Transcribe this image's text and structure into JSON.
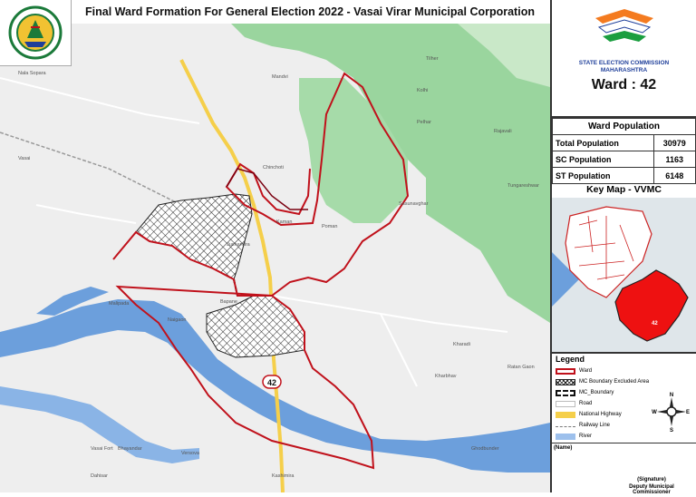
{
  "title": "Final Ward Formation For General Election 2022 - Vasai Virar Municipal Corporation",
  "logo": {
    "icon": "vvmc-emblem",
    "text": "VASAI VIRAR MUNICIPAL CORPORATION"
  },
  "commission": {
    "icon": "election-commission-tricolor-logo",
    "line1": "STATE ELECTION COMMISSION",
    "line2": "MAHARASHTRA",
    "ward_label": "Ward : 42",
    "colors": {
      "saffron": "#f47b20",
      "green": "#1a9e3f",
      "navy": "#1f3f9a"
    }
  },
  "population": {
    "heading": "Ward Population",
    "rows": [
      {
        "label": "Total Population",
        "value": "30979"
      },
      {
        "label": "SC Population",
        "value": "1163"
      },
      {
        "label": "ST Population",
        "value": "6148"
      }
    ]
  },
  "keymap": {
    "title": "Key Map - VVMC",
    "ward_tag": "42",
    "colors": {
      "ward_fill": "#ee1111",
      "boundary": "#cc2222"
    }
  },
  "legend": {
    "title": "Legend",
    "items": [
      {
        "label": "Ward",
        "swatch": "ward-outline"
      },
      {
        "label": "MC Boundary Excluded Area",
        "swatch": "crosshatch"
      },
      {
        "label": "MC_Boundary",
        "swatch": "dashed-box"
      },
      {
        "label": "Road",
        "swatch": "road"
      },
      {
        "label": "National Highway",
        "swatch": "highway"
      },
      {
        "label": "Railway Line",
        "swatch": "railway"
      },
      {
        "label": "River",
        "swatch": "river"
      }
    ],
    "compass": {
      "n": "N",
      "e": "E",
      "s": "S",
      "w": "W"
    }
  },
  "footer": {
    "name_label": "(Name)",
    "signature_label": "(Signature)",
    "designation": "Deputy Municipal Commissioner"
  },
  "map": {
    "ward_badge": "42",
    "colors": {
      "land": "#eeeeee",
      "green": "#9ad59e",
      "water": "#6c9fdc",
      "ward_border": "#c0111b",
      "highway": "#f5cf4a"
    },
    "labels": [
      "Nala Sopara",
      "Vasai",
      "Kaman",
      "Chinchoti",
      "Pelhar",
      "Juchandra",
      "Bapane",
      "Naigaon",
      "Sasunavghar",
      "Kharbhav",
      "Ratan Gaon",
      "Tungareshwar",
      "Kolhi",
      "Rajavali",
      "Ghodbunder",
      "Malipada",
      "Vasai Fort",
      "Versova",
      "Kharadi",
      "Tilher",
      "Poman",
      "Bhayandar",
      "Kashimira",
      "Dahisar",
      "Mandvi"
    ]
  }
}
